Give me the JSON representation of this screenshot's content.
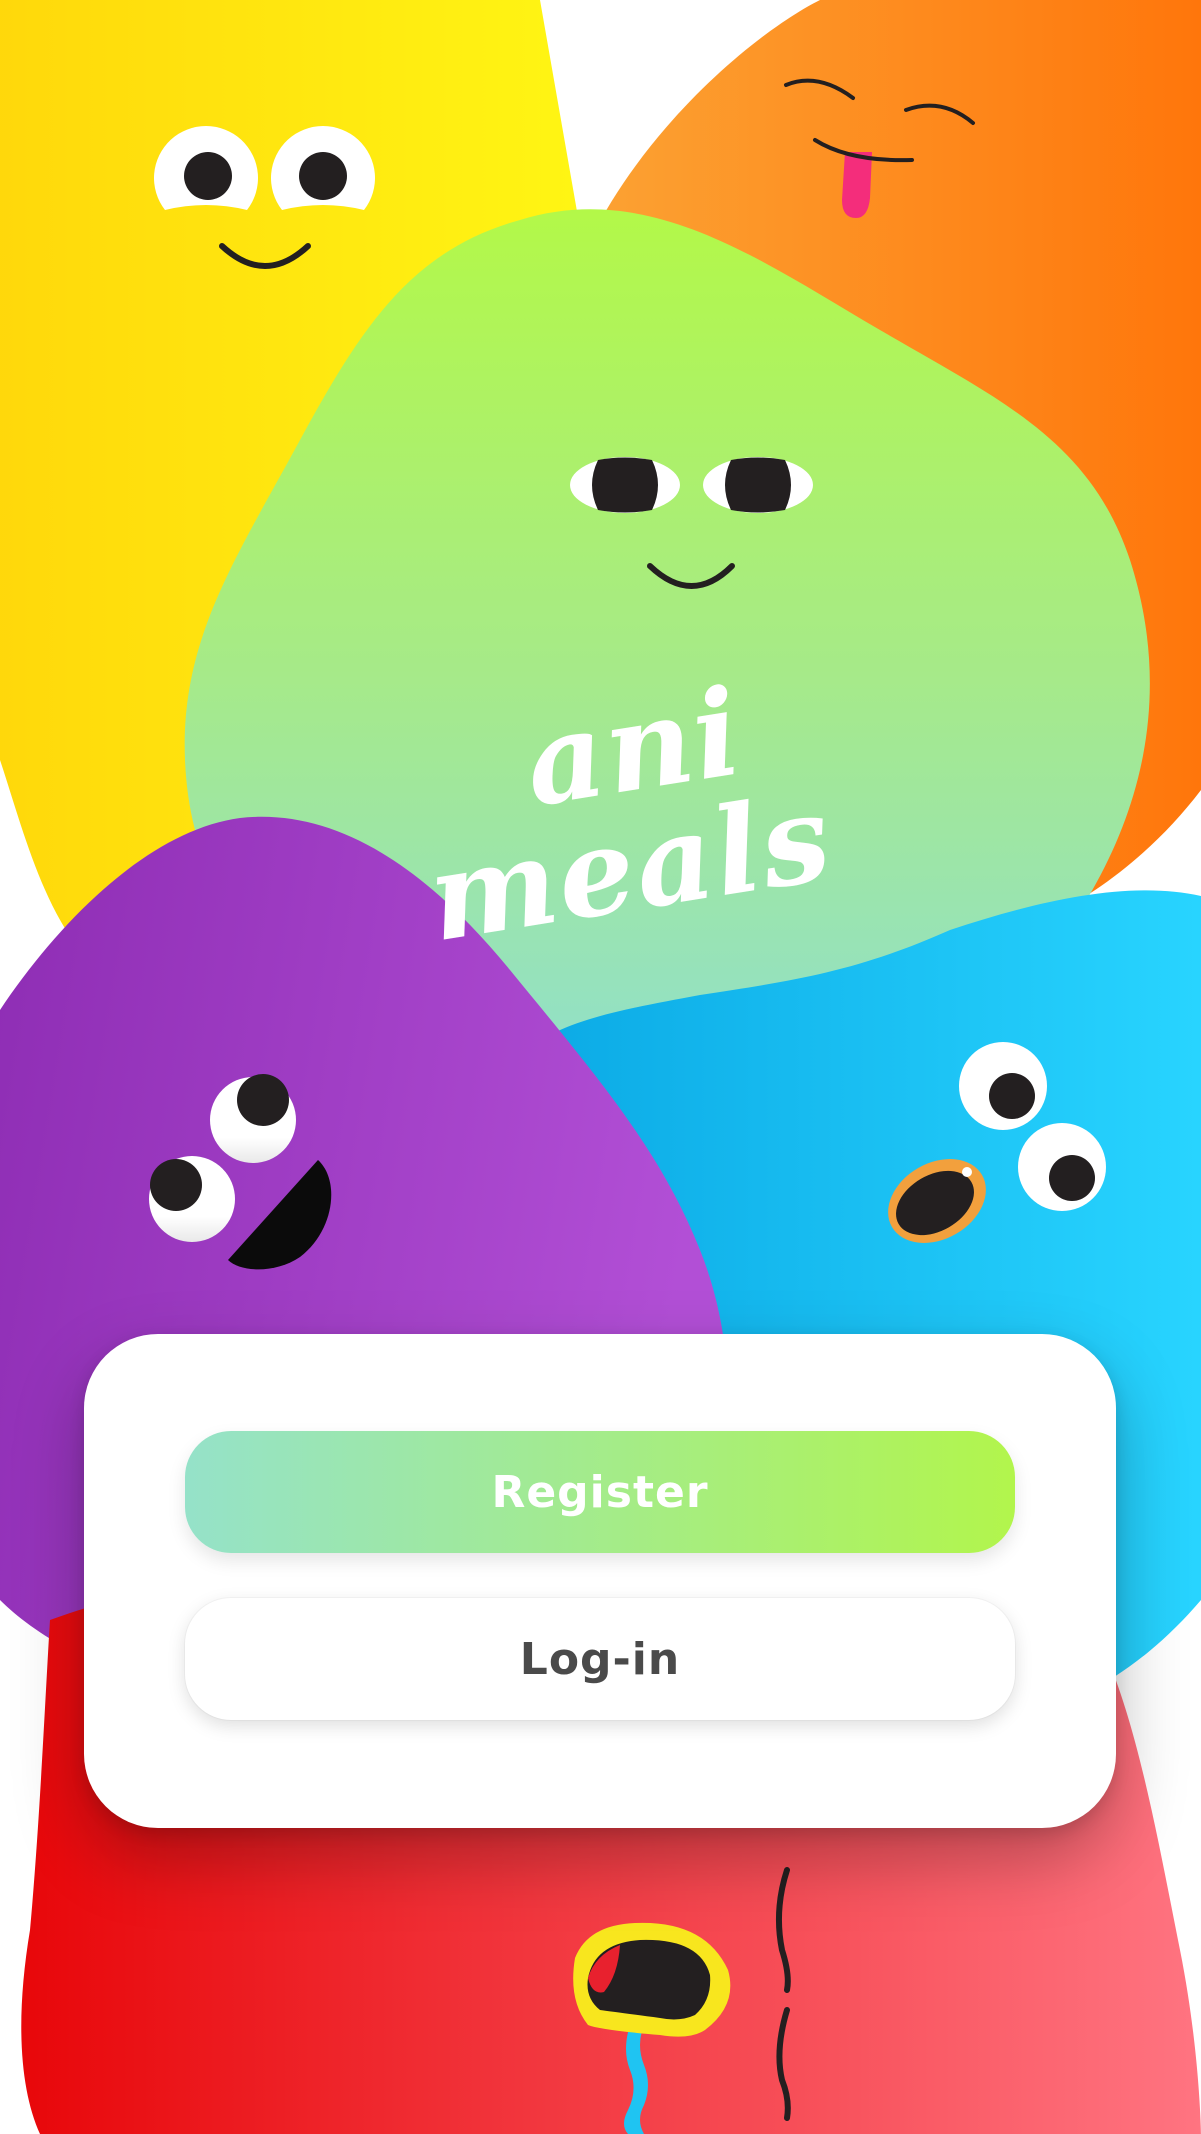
{
  "app": {
    "logo_line1": "ani",
    "logo_line2": "meals"
  },
  "auth": {
    "register_label": "Register",
    "login_label": "Log-in"
  },
  "colors": {
    "yellow_blob": "#ffd60a",
    "orange_blob": "#ff8a1c",
    "green_blob": "#b1f24f",
    "mint_green": "#96e2c6",
    "purple_blob": "#a84dd0",
    "blue_blob": "#19c6f2",
    "red_blob": "#f23444",
    "register_gradient_start": "#95e2c9",
    "register_gradient_end": "#b2f54c",
    "login_text": "#4a4a4a"
  },
  "characters": [
    {
      "name": "yellow-monster",
      "expression": "smile"
    },
    {
      "name": "orange-monster",
      "expression": "tongue-out"
    },
    {
      "name": "green-monster",
      "expression": "calm-smile"
    },
    {
      "name": "purple-monster",
      "expression": "open-mouth"
    },
    {
      "name": "blue-monster",
      "expression": "surprised"
    },
    {
      "name": "red-monster",
      "expression": "drooling"
    }
  ]
}
